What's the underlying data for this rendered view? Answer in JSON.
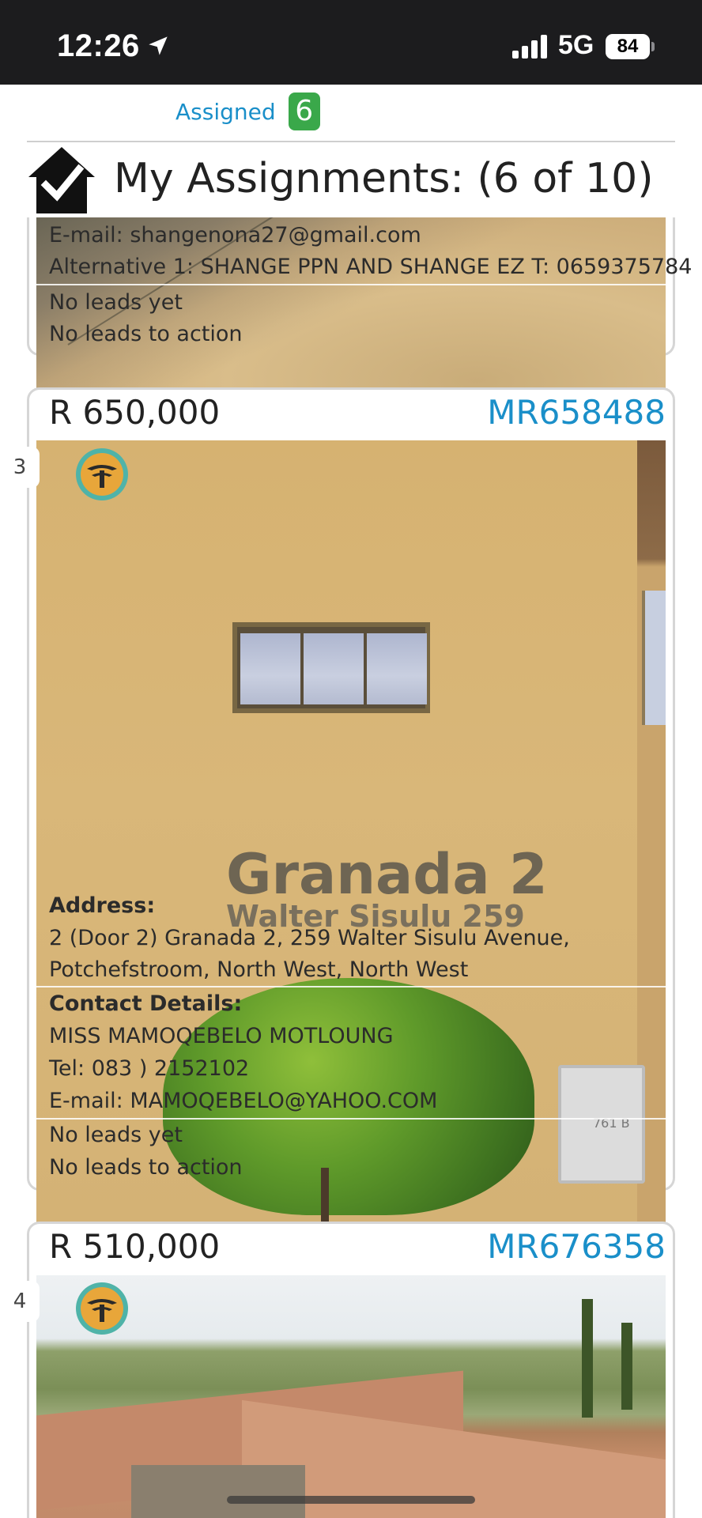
{
  "status_bar": {
    "time": "12:26",
    "network": "5G",
    "battery": "84"
  },
  "header": {
    "tab_label": "Assigned",
    "tab_badge": "6",
    "title": "My Assignments: (6 of 10)",
    "title_icon": "house-check-icon"
  },
  "cards": [
    {
      "email": "E-mail: shangenona27@gmail.com",
      "alternative": "Alternative 1: SHANGE PPN AND SHANGE EZ T: 0659375784",
      "leads": "No leads yet",
      "leads_action": "No leads to action"
    },
    {
      "price": "R 650,000",
      "ref": "MR658488",
      "index": "3",
      "bank_icon": "bank-tree-logo-icon",
      "photo_sign_line1": "Granada 2",
      "photo_sign_line2": "Walter Sisulu 259",
      "photo_meter_label": "761\nB",
      "address_label": "Address:",
      "address_line1": "2 (Door 2) Granada 2, 259 Walter Sisulu Avenue,",
      "address_line2": "Potchefstroom, North West, North West",
      "contact_label": "Contact Details:",
      "contact_name": "MISS MAMOQEBELO MOTLOUNG",
      "contact_tel": "Tel: 083 ) 2152102",
      "contact_email": "E-mail: MAMOQEBELO@YAHOO.COM",
      "leads": "No leads yet",
      "leads_action": "No leads to action"
    },
    {
      "price": "R 510,000",
      "ref": "MR676358",
      "index": "4",
      "bank_icon": "bank-tree-logo-icon"
    }
  ],
  "colors": {
    "accent_blue": "#1a8fc9",
    "badge_green": "#3aa84a",
    "status_bar": "#1c1c1e"
  }
}
